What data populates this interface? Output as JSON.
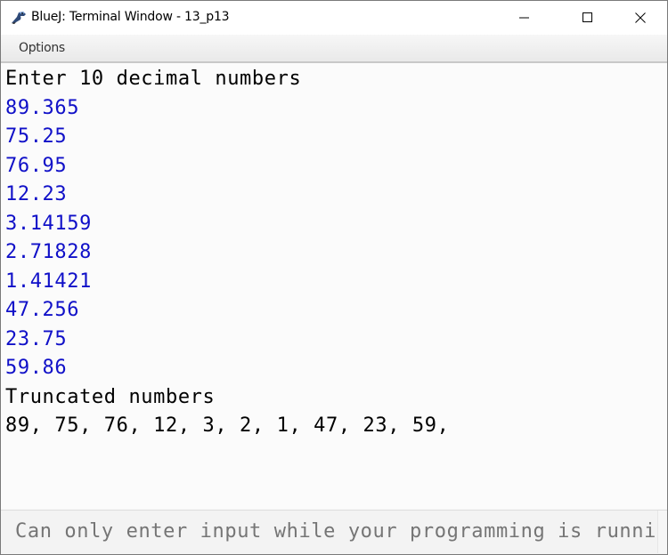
{
  "window": {
    "title": "BlueJ: Terminal Window - 13_p13",
    "app_icon": "bluej-bird-icon",
    "controls": {
      "minimize": "minimize-icon",
      "maximize": "maximize-icon",
      "close": "close-icon"
    }
  },
  "menubar": {
    "items": [
      {
        "label": "Options"
      }
    ]
  },
  "terminal": {
    "colors": {
      "output": "#000000",
      "input": "#1010c8"
    },
    "lines": [
      {
        "type": "output",
        "text": "Enter 10 decimal numbers"
      },
      {
        "type": "input",
        "text": "89.365"
      },
      {
        "type": "input",
        "text": "75.25"
      },
      {
        "type": "input",
        "text": "76.95"
      },
      {
        "type": "input",
        "text": "12.23"
      },
      {
        "type": "input",
        "text": "3.14159"
      },
      {
        "type": "input",
        "text": "2.71828"
      },
      {
        "type": "input",
        "text": "1.41421"
      },
      {
        "type": "input",
        "text": "47.256"
      },
      {
        "type": "input",
        "text": "23.75"
      },
      {
        "type": "input",
        "text": "59.86"
      },
      {
        "type": "output",
        "text": "Truncated numbers"
      },
      {
        "type": "output",
        "text": "89, 75, 76, 12, 3, 2, 1, 47, 23, 59,"
      }
    ]
  },
  "input": {
    "placeholder": "Can only enter input while your programming is running",
    "value": ""
  }
}
